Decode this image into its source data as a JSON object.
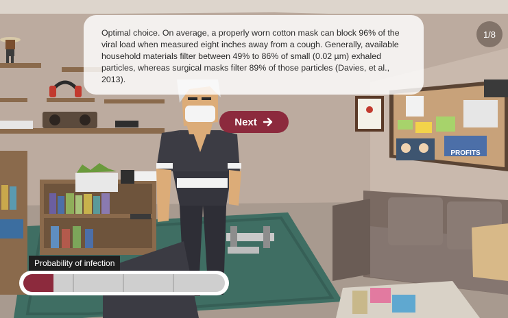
{
  "dialog": {
    "text": "Optimal choice. On average, a properly worn cotton mask can block 96% of the viral load when measured eight inches away from a cough. Generally, available household materials filter between 49% to 86% of small (0.02 µm) exhaled particles, whereas surgical masks filter 89% of those particles (Davies, et al., 2013)."
  },
  "page_counter": "1/8",
  "next_button": {
    "label": "Next",
    "icon": "arrow-right-icon"
  },
  "infection_meter": {
    "label": "Probability of infection",
    "level_fraction": 0.15,
    "segments": 4,
    "fill_color": "#8c2a3d"
  },
  "scene": {
    "corkboard_sign": "PROFITS"
  },
  "colors": {
    "accent": "#8c2a3d",
    "wall": "#b9a89c",
    "rug": "#3f6e63",
    "couch": "#7a6a62"
  }
}
